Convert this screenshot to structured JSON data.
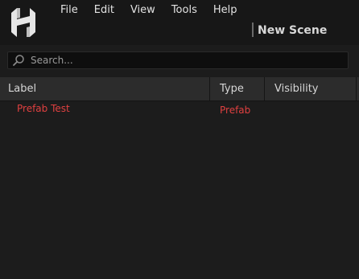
{
  "menu": {
    "items": [
      "File",
      "Edit",
      "View",
      "Tools",
      "Help"
    ]
  },
  "scene": {
    "title": "New Scene"
  },
  "search": {
    "placeholder": "Search..."
  },
  "table": {
    "columns": [
      "Label",
      "Type",
      "Visibility"
    ],
    "rows": [
      {
        "label": "Prefab Test",
        "type": "Prefab",
        "visibility": ""
      }
    ]
  },
  "colors": {
    "background": "#1c1c1c",
    "titlebar": "#171717",
    "header": "#2c2c2c",
    "prefab_text": "#e04040"
  },
  "icons": {
    "logo": "hammer-logo-icon",
    "search": "search-icon"
  }
}
